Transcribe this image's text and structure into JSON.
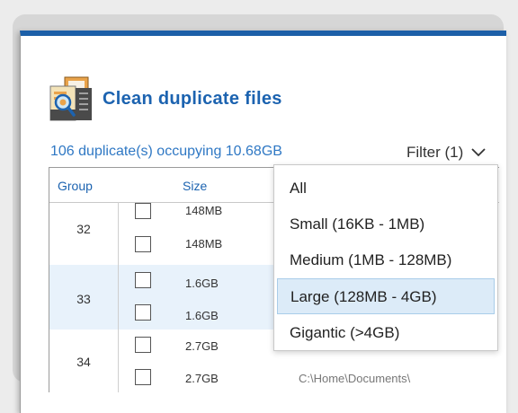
{
  "app": {
    "title": "Clean duplicate files",
    "icon": "duplicate-file-magnifier-icon"
  },
  "summary": "106 duplicate(s) occupying 10.68GB",
  "filter": {
    "label": "Filter (1)",
    "icon": "chevron-down-icon"
  },
  "table": {
    "columns": {
      "group": "Group",
      "size": "Size"
    },
    "groups": [
      {
        "id": "32",
        "rows": [
          {
            "size": "148MB",
            "path": ""
          },
          {
            "size": "148MB",
            "path": ""
          }
        ]
      },
      {
        "id": "33",
        "rows": [
          {
            "size": "1.6GB",
            "path": ""
          },
          {
            "size": "1.6GB",
            "path": ""
          }
        ]
      },
      {
        "id": "34",
        "rows": [
          {
            "size": "2.7GB",
            "path": ""
          },
          {
            "size": "2.7GB",
            "path": "C:\\Home\\Documents\\"
          }
        ]
      }
    ]
  },
  "dropdown": {
    "options": [
      "All",
      "Small (16KB - 1MB)",
      "Medium (1MB - 128MB)",
      "Large (128MB - 4GB)",
      "Gigantic (>4GB)"
    ],
    "selected": "Large (128MB - 4GB)"
  },
  "colors": {
    "accent": "#1c63b0",
    "selection": "#dcebf8",
    "row_highlight": "#e8f2fb"
  }
}
